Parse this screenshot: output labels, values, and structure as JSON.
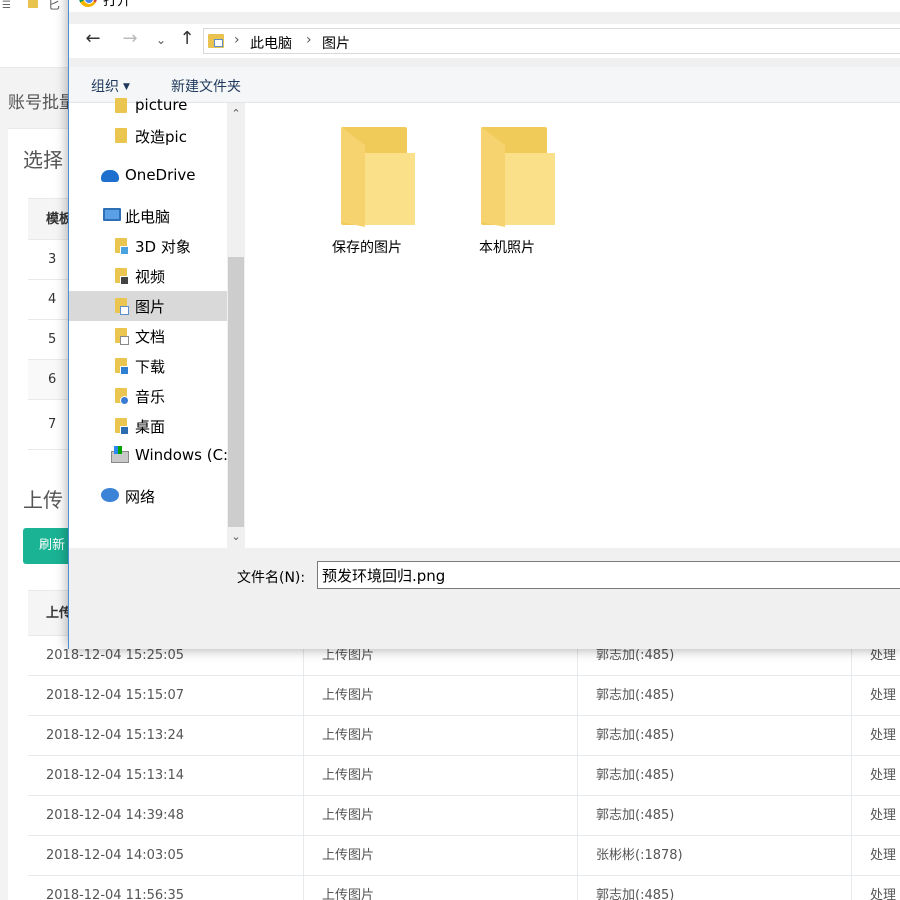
{
  "background": {
    "topbar_icon": "☰",
    "topbar_text": "匕",
    "breadcrumb": "账号批量",
    "section1_title": "选择",
    "small_table": {
      "header": "模板",
      "rows": [
        "3",
        "4",
        "5",
        "6",
        "7"
      ]
    },
    "section2_title": "上传",
    "refresh_button": "刷新",
    "log_table": {
      "header": "上传",
      "rows": [
        {
          "time": "2018-12-04 15:25:05",
          "action": "上传图片",
          "user": "郭志加(:485)",
          "op": "处理"
        },
        {
          "time": "2018-12-04 15:15:07",
          "action": "上传图片",
          "user": "郭志加(:485)",
          "op": "处理"
        },
        {
          "time": "2018-12-04 15:13:24",
          "action": "上传图片",
          "user": "郭志加(:485)",
          "op": "处理"
        },
        {
          "time": "2018-12-04 15:13:14",
          "action": "上传图片",
          "user": "郭志加(:485)",
          "op": "处理"
        },
        {
          "time": "2018-12-04 14:39:48",
          "action": "上传图片",
          "user": "郭志加(:485)",
          "op": "处理"
        },
        {
          "time": "2018-12-04 14:03:05",
          "action": "上传图片",
          "user": "张彬彬(:1878)",
          "op": "处理"
        },
        {
          "time": "2018-12-04 11:56:35",
          "action": "上传图片",
          "user": "郭志加(:485)",
          "op": "处理"
        }
      ]
    }
  },
  "dialog": {
    "title": "打开",
    "nav": {
      "back": "←",
      "forward": "→",
      "recent": "⌄",
      "up": "↑",
      "path": [
        "此电脑",
        "图片"
      ],
      "separator": "›"
    },
    "toolbar": {
      "organize": "组织",
      "organize_caret": "▼",
      "new_folder": "新建文件夹"
    },
    "tree": [
      {
        "label": "picture",
        "icon": "folder-icon"
      },
      {
        "label": "改造pic",
        "icon": "folder-icon"
      },
      {
        "label": "OneDrive",
        "icon": "cloud-icon"
      },
      {
        "label": "此电脑",
        "icon": "computer-icon"
      },
      {
        "label": "3D 对象",
        "icon": "3d-objects-icon"
      },
      {
        "label": "视频",
        "icon": "video-icon"
      },
      {
        "label": "图片",
        "icon": "pictures-icon",
        "selected": true
      },
      {
        "label": "文档",
        "icon": "documents-icon"
      },
      {
        "label": "下载",
        "icon": "downloads-icon"
      },
      {
        "label": "音乐",
        "icon": "music-icon"
      },
      {
        "label": "桌面",
        "icon": "desktop-icon"
      },
      {
        "label": "Windows (C:)",
        "icon": "drive-icon"
      },
      {
        "label": "网络",
        "icon": "network-icon"
      }
    ],
    "scroll": {
      "up": "⌃",
      "down": "⌄"
    },
    "folders": [
      {
        "label": "保存的图片"
      },
      {
        "label": "本机照片"
      }
    ],
    "filename_label": "文件名(N):",
    "filename_value": "预发环境回归.png"
  },
  "colors": {
    "accent": "#1ab394",
    "dialog_border": "#4a90d9",
    "folder": "#f1cb5a",
    "selected": "#d9d9d9"
  }
}
